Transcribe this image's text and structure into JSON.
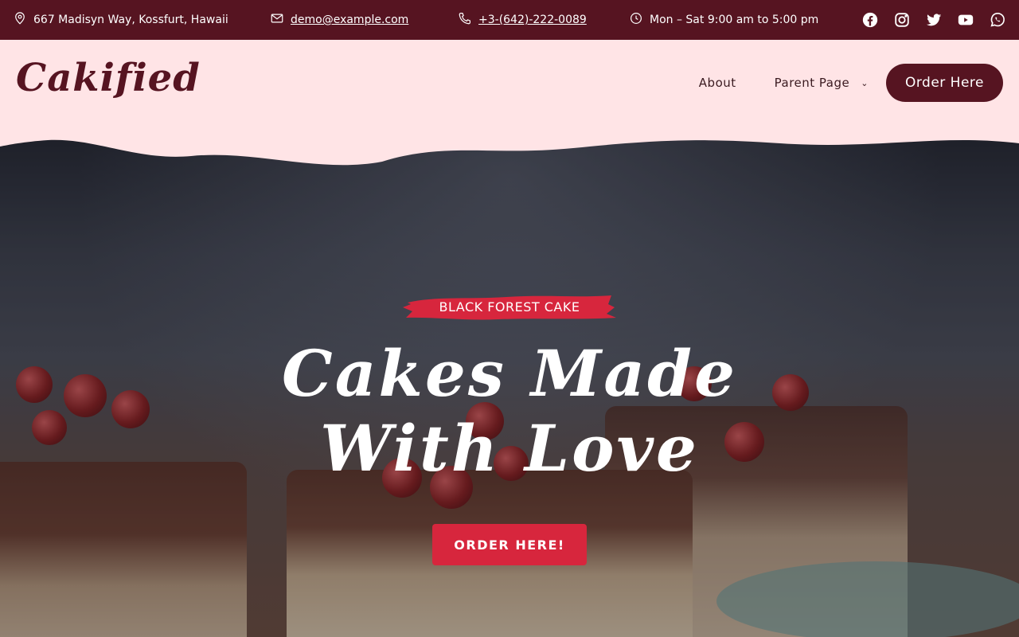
{
  "topbar": {
    "address": "667 Madisyn Way, Kossfurt, Hawaii",
    "email": "demo@example.com",
    "phone": "+3-(642)-222-0089",
    "hours": "Mon – Sat 9:00 am to 5:00 pm",
    "icons": {
      "address": "map-pin-icon",
      "email": "envelope-icon",
      "phone": "phone-icon",
      "hours": "clock-icon"
    },
    "socials": [
      "facebook-icon",
      "instagram-icon",
      "twitter-icon",
      "youtube-icon",
      "whatsapp-icon"
    ]
  },
  "header": {
    "logo": "Cakified",
    "nav": {
      "about": "About",
      "parent_page": "Parent Page",
      "order_button": "Order Here"
    }
  },
  "hero": {
    "tag": "BLACK FOREST CAKE",
    "title": "Cakes Made With Love",
    "button": "ORDER HERE!"
  },
  "colors": {
    "topbar_bg": "#561421",
    "header_bg": "#ffe4e6",
    "brand": "#561421",
    "accent": "#d7263d"
  }
}
